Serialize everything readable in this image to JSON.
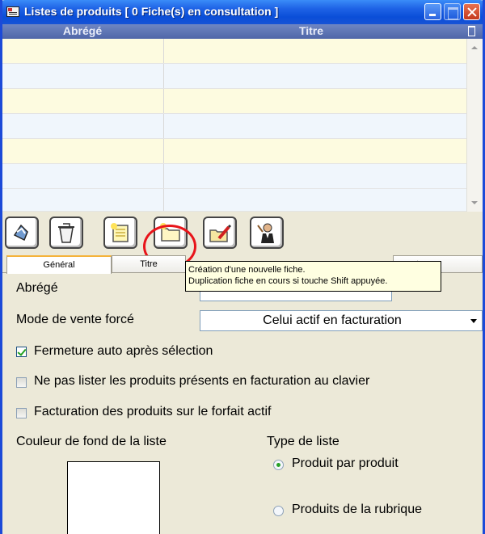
{
  "window": {
    "title": "Listes de produits  [ 0 Fiche(s) en consultation ]"
  },
  "grid": {
    "columns": [
      "Abrégé",
      "Titre"
    ],
    "rows": 7
  },
  "toolbar": {
    "buttons": [
      "recycle-icon",
      "trash-bin-icon",
      "new-record-icon",
      "duplicate-record-icon",
      "edit-record-icon",
      "agent-icon"
    ],
    "highlighted": "duplicate-record-icon"
  },
  "tabs": [
    "Général",
    "Titre",
    "tenu"
  ],
  "tooltip": {
    "line1": "Création d'une nouvelle fiche.",
    "line2": "Duplication fiche en cours si touche Shift appuyée."
  },
  "form": {
    "abrege_label": "Abrégé",
    "abrege_value": "",
    "mode_label": "Mode de vente forcé",
    "mode_value": "Celui actif en facturation",
    "cb_fermeture": {
      "label": "Fermeture auto après sélection",
      "checked": true
    },
    "cb_ne_pas_lister": {
      "label": "Ne pas lister les produits présents en facturation au clavier",
      "checked": false
    },
    "cb_facturation": {
      "label": "Facturation des produits sur le forfait actif",
      "checked": false
    },
    "couleur_label": "Couleur de fond de la liste",
    "type_label": "Type de liste",
    "radio_produit": {
      "label": "Produit par produit",
      "selected": true
    },
    "radio_rubrique": {
      "label": "Produits de la rubrique",
      "selected": false
    }
  },
  "colors": {
    "titlebar": "#0a4ed8",
    "grid_header": "#5a71b2",
    "row_a": "#fdfbe0",
    "row_b": "#f0f6fc",
    "highlight": "#e8141a"
  }
}
